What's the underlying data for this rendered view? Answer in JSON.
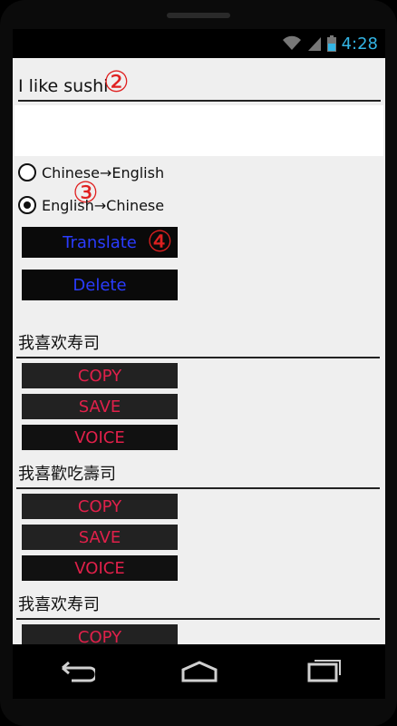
{
  "status": {
    "time": "4:28"
  },
  "input": {
    "value": "I like sushi"
  },
  "markers": {
    "m2": "②",
    "m3": "③",
    "m4": "④"
  },
  "radios": [
    {
      "label": "Chinese→English",
      "checked": false
    },
    {
      "label": "English→Chinese",
      "checked": true
    }
  ],
  "buttons": {
    "translate": "Translate",
    "delete": "Delete"
  },
  "results": [
    {
      "text": "我喜欢寿司",
      "copy": "COPY",
      "save": "SAVE",
      "voice": "VOICE"
    },
    {
      "text": "我喜歡吃壽司",
      "copy": "COPY",
      "save": "SAVE",
      "voice": "VOICE"
    },
    {
      "text": "我喜欢寿司",
      "copy": "COPY"
    }
  ],
  "colors": {
    "status_time": "#33b5e5",
    "blue_button_text": "#2a3cff",
    "red_button_text": "#e0204a",
    "marker": "#e02020"
  },
  "icons": [
    "wifi-icon",
    "signal-icon",
    "battery-icon",
    "back-icon",
    "home-icon",
    "recents-icon"
  ]
}
